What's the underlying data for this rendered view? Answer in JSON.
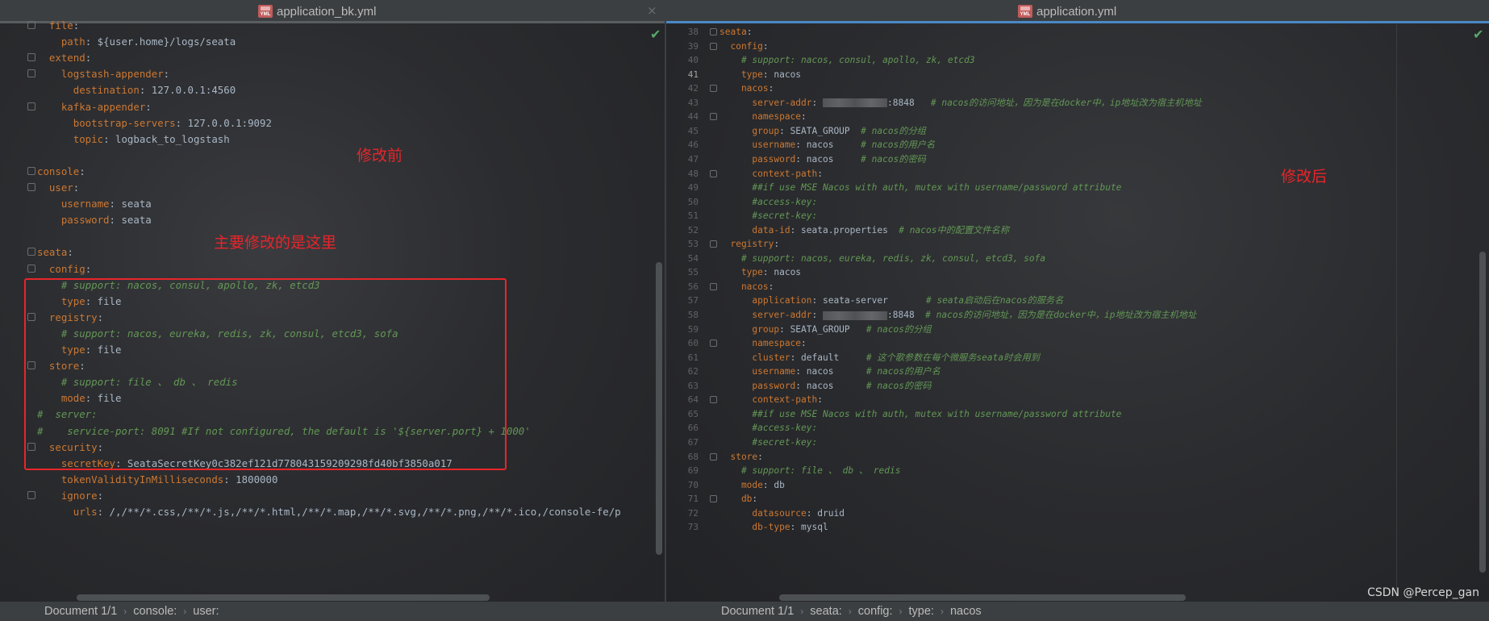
{
  "left": {
    "tab_title": "application_bk.yml",
    "close": "×",
    "annotation_before": "修改前",
    "annotation_main": "主要修改的是这里",
    "lines": [
      [
        [
          "k",
          "  file"
        ],
        [
          "v",
          ":"
        ]
      ],
      [
        [
          "k",
          "    path"
        ],
        [
          "v",
          ": ${user.home}/logs/seata"
        ]
      ],
      [
        [
          "k",
          "  extend"
        ],
        [
          "v",
          ":"
        ]
      ],
      [
        [
          "k",
          "    logstash-appender"
        ],
        [
          "v",
          ":"
        ]
      ],
      [
        [
          "k",
          "      destination"
        ],
        [
          "v",
          ": 127.0.0.1:4560"
        ]
      ],
      [
        [
          "k",
          "    kafka-appender"
        ],
        [
          "v",
          ":"
        ]
      ],
      [
        [
          "k",
          "      bootstrap-servers"
        ],
        [
          "v",
          ": 127.0.0.1:9092"
        ]
      ],
      [
        [
          "k",
          "      topic"
        ],
        [
          "v",
          ": logback_to_logstash"
        ]
      ],
      [],
      [
        [
          "k",
          "console"
        ],
        [
          "v",
          ":"
        ]
      ],
      [
        [
          "k",
          "  user"
        ],
        [
          "v",
          ":"
        ]
      ],
      [
        [
          "k",
          "    username"
        ],
        [
          "v",
          ": seata"
        ]
      ],
      [
        [
          "k",
          "    password"
        ],
        [
          "v",
          ": seata"
        ]
      ],
      [],
      [
        [
          "k",
          "seata"
        ],
        [
          "v",
          ":"
        ]
      ],
      [
        [
          "k",
          "  config"
        ],
        [
          "v",
          ":"
        ]
      ],
      [
        [
          "c",
          "    # support: nacos, consul, apollo, zk, etcd3"
        ]
      ],
      [
        [
          "k",
          "    type"
        ],
        [
          "v",
          ": file"
        ]
      ],
      [
        [
          "k",
          "  registry"
        ],
        [
          "v",
          ":"
        ]
      ],
      [
        [
          "c",
          "    # support: nacos, eureka, redis, zk, consul, etcd3, sofa"
        ]
      ],
      [
        [
          "k",
          "    type"
        ],
        [
          "v",
          ": file"
        ]
      ],
      [
        [
          "k",
          "  store"
        ],
        [
          "v",
          ":"
        ]
      ],
      [
        [
          "c",
          "    # support: file 、 db 、 redis"
        ]
      ],
      [
        [
          "k",
          "    mode"
        ],
        [
          "v",
          ": file"
        ]
      ],
      [
        [
          "c",
          "#  server:"
        ]
      ],
      [
        [
          "c",
          "#    service-port: 8091 #If not configured, the default is '${server.port} + 1000'"
        ]
      ],
      [
        [
          "k",
          "  security"
        ],
        [
          "v",
          ":"
        ]
      ],
      [
        [
          "k",
          "    secretKey"
        ],
        [
          "v",
          ": SeataSecretKey0c382ef121d778043159209298fd40bf3850a017"
        ]
      ],
      [
        [
          "k",
          "    tokenValidityInMilliseconds"
        ],
        [
          "v",
          ": 1800000"
        ]
      ],
      [
        [
          "k",
          "    ignore"
        ],
        [
          "v",
          ":"
        ]
      ],
      [
        [
          "k",
          "      urls"
        ],
        [
          "v",
          ": /,/**/*.css,/**/*.js,/**/*.html,/**/*.map,/**/*.svg,/**/*.png,/**/*.ico,/console-fe/p"
        ]
      ]
    ],
    "breadcrumb": [
      "Document 1/1",
      "console:",
      "user:"
    ]
  },
  "right": {
    "tab_title": "application.yml",
    "close": "×",
    "annotation_after": "修改后",
    "current_line": 41,
    "lines": [
      {
        "n": 38,
        "t": [
          [
            "k",
            "seata"
          ],
          [
            "v",
            ":"
          ]
        ]
      },
      {
        "n": 39,
        "t": [
          [
            "k",
            "  config"
          ],
          [
            "v",
            ":"
          ]
        ]
      },
      {
        "n": 40,
        "t": [
          [
            "c",
            "    # support: nacos, consul, apollo, zk, etcd3"
          ]
        ]
      },
      {
        "n": 41,
        "t": [
          [
            "k",
            "    type"
          ],
          [
            "v",
            ": nacos"
          ]
        ]
      },
      {
        "n": 42,
        "t": [
          [
            "k",
            "    nacos"
          ],
          [
            "v",
            ":"
          ]
        ]
      },
      {
        "n": 43,
        "t": [
          [
            "k",
            "      server-addr"
          ],
          [
            "v",
            ": "
          ],
          [
            "blur",
            ""
          ],
          [
            "v",
            ":8848  "
          ],
          [
            "c",
            " # nacos的访问地址，因为是在docker中，ip地址改为宿主机地址"
          ]
        ]
      },
      {
        "n": 44,
        "t": [
          [
            "k",
            "      namespace"
          ],
          [
            "v",
            ":"
          ]
        ]
      },
      {
        "n": 45,
        "t": [
          [
            "k",
            "      group"
          ],
          [
            "v",
            ": SEATA_GROUP  "
          ],
          [
            "c",
            "# nacos的分组"
          ]
        ]
      },
      {
        "n": 46,
        "t": [
          [
            "k",
            "      username"
          ],
          [
            "v",
            ": nacos     "
          ],
          [
            "c",
            "# nacos的用户名"
          ]
        ]
      },
      {
        "n": 47,
        "t": [
          [
            "k",
            "      password"
          ],
          [
            "v",
            ": nacos     "
          ],
          [
            "c",
            "# nacos的密码"
          ]
        ]
      },
      {
        "n": 48,
        "t": [
          [
            "k",
            "      context-path"
          ],
          [
            "v",
            ":"
          ]
        ]
      },
      {
        "n": 49,
        "t": [
          [
            "c",
            "      ##if use MSE Nacos with auth, mutex with username/password attribute"
          ]
        ]
      },
      {
        "n": 50,
        "t": [
          [
            "c",
            "      #access-key:"
          ]
        ]
      },
      {
        "n": 51,
        "t": [
          [
            "c",
            "      #secret-key:"
          ]
        ]
      },
      {
        "n": 52,
        "t": [
          [
            "k",
            "      data-id"
          ],
          [
            "v",
            ": seata.properties  "
          ],
          [
            "c",
            "# nacos中的配置文件名称"
          ]
        ]
      },
      {
        "n": 53,
        "t": [
          [
            "k",
            "  registry"
          ],
          [
            "v",
            ":"
          ]
        ]
      },
      {
        "n": 54,
        "t": [
          [
            "c",
            "    # support: nacos, eureka, redis, zk, consul, etcd3, sofa"
          ]
        ]
      },
      {
        "n": 55,
        "t": [
          [
            "k",
            "    type"
          ],
          [
            "v",
            ": nacos"
          ]
        ]
      },
      {
        "n": 56,
        "t": [
          [
            "k",
            "    nacos"
          ],
          [
            "v",
            ":"
          ]
        ]
      },
      {
        "n": 57,
        "t": [
          [
            "k",
            "      application"
          ],
          [
            "v",
            ": seata-server       "
          ],
          [
            "c",
            "# seata启动后在nacos的服务名"
          ]
        ]
      },
      {
        "n": 58,
        "t": [
          [
            "k",
            "      server-addr"
          ],
          [
            "v",
            ": "
          ],
          [
            "blur",
            ""
          ],
          [
            "v",
            ":8848  "
          ],
          [
            "c",
            "# nacos的访问地址，因为是在docker中，ip地址改为宿主机地址"
          ]
        ]
      },
      {
        "n": 59,
        "t": [
          [
            "k",
            "      group"
          ],
          [
            "v",
            ": SEATA_GROUP   "
          ],
          [
            "c",
            "# nacos的分组"
          ]
        ]
      },
      {
        "n": 60,
        "t": [
          [
            "k",
            "      namespace"
          ],
          [
            "v",
            ":"
          ]
        ]
      },
      {
        "n": 61,
        "t": [
          [
            "k",
            "      cluster"
          ],
          [
            "v",
            ": default     "
          ],
          [
            "c",
            "# 这个歌参数在每个微服务seata时会用到"
          ]
        ]
      },
      {
        "n": 62,
        "t": [
          [
            "k",
            "      username"
          ],
          [
            "v",
            ": nacos      "
          ],
          [
            "c",
            "# nacos的用户名"
          ]
        ]
      },
      {
        "n": 63,
        "t": [
          [
            "k",
            "      password"
          ],
          [
            "v",
            ": nacos      "
          ],
          [
            "c",
            "# nacos的密码"
          ]
        ]
      },
      {
        "n": 64,
        "t": [
          [
            "k",
            "      context-path"
          ],
          [
            "v",
            ":"
          ]
        ]
      },
      {
        "n": 65,
        "t": [
          [
            "c",
            "      ##if use MSE Nacos with auth, mutex with username/password attribute"
          ]
        ]
      },
      {
        "n": 66,
        "t": [
          [
            "c",
            "      #access-key:"
          ]
        ]
      },
      {
        "n": 67,
        "t": [
          [
            "c",
            "      #secret-key:"
          ]
        ]
      },
      {
        "n": 68,
        "t": [
          [
            "k",
            "  store"
          ],
          [
            "v",
            ":"
          ]
        ]
      },
      {
        "n": 69,
        "t": [
          [
            "c",
            "    # support: file 、 db 、 redis"
          ]
        ]
      },
      {
        "n": 70,
        "t": [
          [
            "k",
            "    mode"
          ],
          [
            "v",
            ": db"
          ]
        ]
      },
      {
        "n": 71,
        "t": [
          [
            "k",
            "    db"
          ],
          [
            "v",
            ":"
          ]
        ]
      },
      {
        "n": 72,
        "t": [
          [
            "k",
            "      datasource"
          ],
          [
            "v",
            ": druid"
          ]
        ]
      },
      {
        "n": 73,
        "t": [
          [
            "k",
            "      db-type"
          ],
          [
            "v",
            ": mysql"
          ]
        ]
      }
    ],
    "breadcrumb": [
      "Document 1/1",
      "seata:",
      "config:",
      "type:",
      "nacos"
    ]
  },
  "watermark": "CSDN @Percep_gan",
  "colors": {
    "key": "#cc7832",
    "comment": "#629755",
    "text": "#a9b7c6",
    "annotation": "#e8252a",
    "active_tab": "#4a88c7"
  }
}
